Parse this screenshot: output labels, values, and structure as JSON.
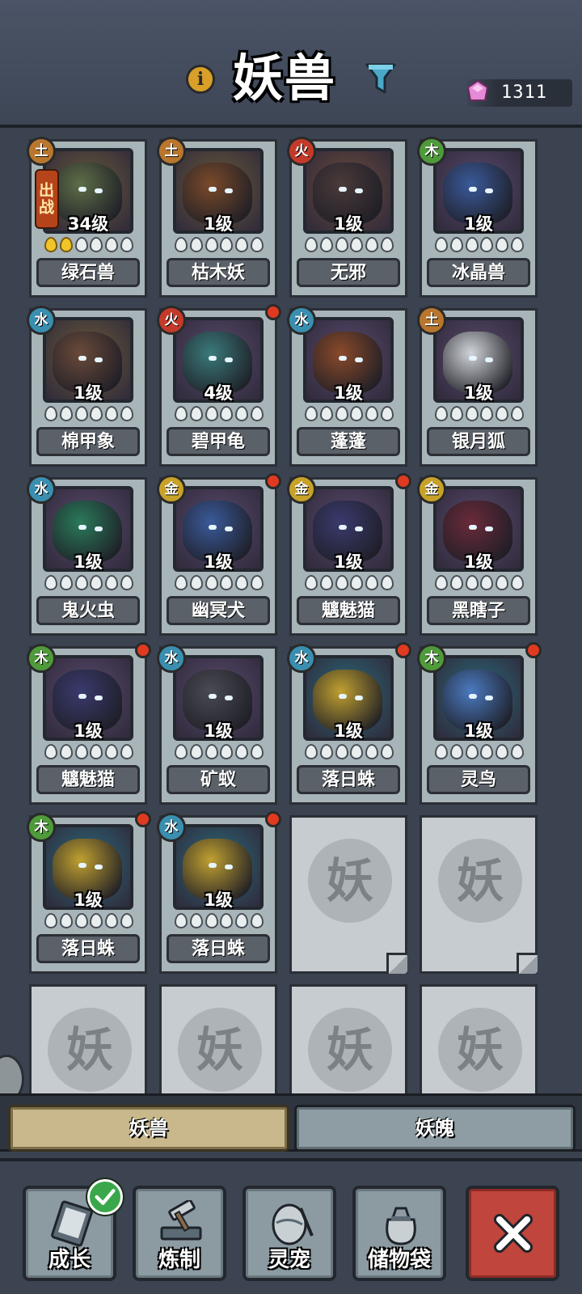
{
  "header": {
    "title": "妖兽",
    "info_icon": "info-icon",
    "filter_icon": "filter-icon",
    "gem_icon": "pink-gem-icon",
    "gem_count": "1311"
  },
  "beasts": [
    {
      "name": "绿石兽",
      "level": "34级",
      "element": "土",
      "deployed_label": "出战",
      "stars_gold": 2,
      "stars_total": 6,
      "notify": false,
      "element_color": "#b8762e",
      "bg": "#6b5a3a",
      "body": "#5e6e48"
    },
    {
      "name": "枯木妖",
      "level": "1级",
      "element": "土",
      "stars_gold": 0,
      "stars_total": 6,
      "notify": false,
      "element_color": "#b8762e",
      "bg": "#6b5a3a",
      "body": "#7a4a2a"
    },
    {
      "name": "无邪",
      "level": "1级",
      "element": "火",
      "stars_gold": 0,
      "stars_total": 6,
      "notify": false,
      "element_color": "#c43a2a",
      "bg": "#6b4a3a",
      "body": "#4a3a3a"
    },
    {
      "name": "冰晶兽",
      "level": "1级",
      "element": "木",
      "stars_gold": 0,
      "stars_total": 6,
      "notify": false,
      "element_color": "#4f9a3a",
      "bg": "#5a4a6e",
      "body": "#3a5a9a"
    },
    {
      "name": "棉甲象",
      "level": "1级",
      "element": "水",
      "stars_gold": 0,
      "stars_total": 6,
      "notify": false,
      "element_color": "#3a8fb0",
      "bg": "#6b5a3a",
      "body": "#6a4a3a"
    },
    {
      "name": "碧甲龟",
      "level": "4级",
      "element": "火",
      "stars_gold": 0,
      "stars_total": 6,
      "notify": true,
      "element_color": "#c43a2a",
      "bg": "#5a4a6e",
      "body": "#3a7a7a"
    },
    {
      "name": "蓬蓬",
      "level": "1级",
      "element": "水",
      "stars_gold": 0,
      "stars_total": 6,
      "notify": false,
      "element_color": "#3a8fb0",
      "bg": "#5a4a6e",
      "body": "#8a4a2a"
    },
    {
      "name": "银月狐",
      "level": "1级",
      "element": "土",
      "stars_gold": 0,
      "stars_total": 6,
      "notify": false,
      "element_color": "#b8762e",
      "bg": "#5a4a6e",
      "body": "#d0d4d8"
    },
    {
      "name": "鬼火虫",
      "level": "1级",
      "element": "水",
      "stars_gold": 0,
      "stars_total": 6,
      "notify": false,
      "element_color": "#3a8fb0",
      "bg": "#5a4a6e",
      "body": "#2a7a5a"
    },
    {
      "name": "幽冥犬",
      "level": "1级",
      "element": "金",
      "stars_gold": 0,
      "stars_total": 6,
      "notify": true,
      "element_color": "#c8a228",
      "bg": "#5a4a6e",
      "body": "#3a5a9a"
    },
    {
      "name": "魑魅猫",
      "level": "1级",
      "element": "金",
      "stars_gold": 0,
      "stars_total": 6,
      "notify": true,
      "element_color": "#c8a228",
      "bg": "#5a4a6e",
      "body": "#3a3a6e"
    },
    {
      "name": "黑瞎子",
      "level": "1级",
      "element": "金",
      "stars_gold": 0,
      "stars_total": 6,
      "notify": false,
      "element_color": "#c8a228",
      "bg": "#5a4a6e",
      "body": "#6a2a3a"
    },
    {
      "name": "魑魅猫",
      "level": "1级",
      "element": "木",
      "stars_gold": 0,
      "stars_total": 6,
      "notify": true,
      "element_color": "#4f9a3a",
      "bg": "#5a4a6e",
      "body": "#3a3a6e"
    },
    {
      "name": "矿蚁",
      "level": "1级",
      "element": "水",
      "stars_gold": 0,
      "stars_total": 6,
      "notify": false,
      "element_color": "#3a8fb0",
      "bg": "#5a4a6e",
      "body": "#4a4a52"
    },
    {
      "name": "落日蛛",
      "level": "1级",
      "element": "水",
      "stars_gold": 0,
      "stars_total": 6,
      "notify": true,
      "element_color": "#3a8fb0",
      "bg": "#2a6a7a",
      "body": "#c0a030"
    },
    {
      "name": "灵鸟",
      "level": "1级",
      "element": "木",
      "stars_gold": 0,
      "stars_total": 6,
      "notify": true,
      "element_color": "#4f9a3a",
      "bg": "#2a6a7a",
      "body": "#4a7ac0"
    },
    {
      "name": "落日蛛",
      "level": "1级",
      "element": "木",
      "stars_gold": 0,
      "stars_total": 6,
      "notify": true,
      "element_color": "#4f9a3a",
      "bg": "#2a6a7a",
      "body": "#c0a030"
    },
    {
      "name": "落日蛛",
      "level": "1级",
      "element": "水",
      "stars_gold": 0,
      "stars_total": 6,
      "notify": true,
      "element_color": "#3a8fb0",
      "bg": "#2a6a7a",
      "body": "#c0a030"
    }
  ],
  "empty_slot_label": "妖",
  "tabs": [
    {
      "label": "妖兽",
      "active": true
    },
    {
      "label": "妖魄",
      "active": false
    }
  ],
  "nav": [
    {
      "label": "成长",
      "icon": "growth-book-icon",
      "badge": "check-icon"
    },
    {
      "label": "炼制",
      "icon": "hammer-anvil-icon"
    },
    {
      "label": "灵宠",
      "icon": "pet-egg-icon"
    },
    {
      "label": "储物袋",
      "icon": "storage-bag-icon"
    }
  ],
  "close_icon": "close-icon"
}
